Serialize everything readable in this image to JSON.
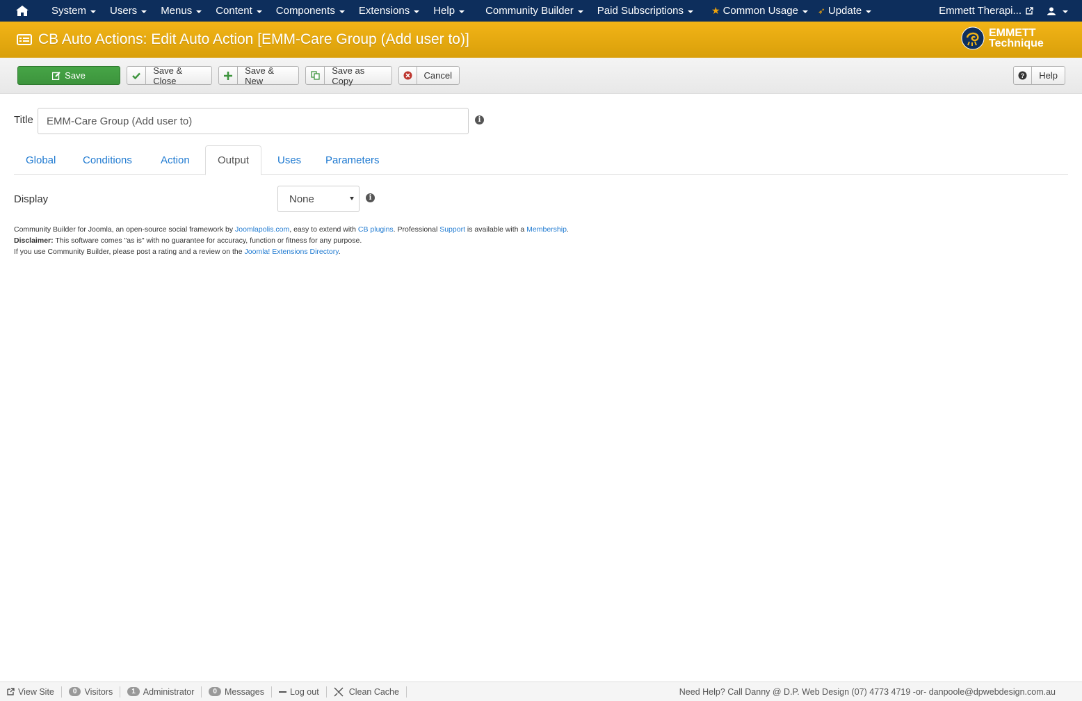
{
  "topnav": {
    "items": [
      "System",
      "Users",
      "Menus",
      "Content",
      "Components",
      "Extensions",
      "Help"
    ],
    "extra": [
      "Community Builder",
      "Paid Subscriptions"
    ],
    "common_usage": "Common Usage",
    "update": "Update",
    "site_name": "Emmett Therapi...",
    "icons": {
      "home": "home-icon",
      "user": "user-icon",
      "external": "external-link-icon"
    }
  },
  "header": {
    "title": "CB Auto Actions: Edit Auto Action [EMM-Care Group (Add user to)]",
    "brand_line1": "EMMETT",
    "brand_line2": "Technique",
    "color": "#e8a811"
  },
  "toolbar": {
    "save": "Save",
    "save_close": "Save & Close",
    "save_new": "Save & New",
    "save_copy": "Save as Copy",
    "cancel": "Cancel",
    "help": "Help"
  },
  "form": {
    "title_label": "Title",
    "title_value": "EMM-Care Group (Add user to)",
    "tabs": [
      "Global",
      "Conditions",
      "Action",
      "Output",
      "Uses",
      "Parameters"
    ],
    "active_tab": "Output",
    "display_label": "Display",
    "display_value": "None"
  },
  "footer": {
    "line1_a": "Community Builder for Joomla, an open-source social framework by ",
    "line1_link1": "Joomlapolis.com",
    "line1_b": ", easy to extend with ",
    "line1_link2": "CB plugins",
    "line1_c": ". Professional ",
    "line1_link3": "Support",
    "line1_d": " is available with a ",
    "line1_link4": "Membership",
    "line1_e": ".",
    "disclaimer_label": "Disclaimer:",
    "disclaimer_text": " This software comes \"as is\" with no guarantee for accuracy, function or fitness for any purpose.",
    "line3_a": "If you use Community Builder, please post a rating and a review on the ",
    "line3_link": "Joomla! Extensions Directory",
    "line3_b": "."
  },
  "statusbar": {
    "view_site": "View Site",
    "visitors_count": "0",
    "visitors": "Visitors",
    "admin_count": "1",
    "admin": "Administrator",
    "messages_count": "0",
    "messages": "Messages",
    "logout": "Log out",
    "clean_cache": "Clean Cache",
    "help_text": "Need Help? Call Danny @ D.P. Web Design (07) 4773 4719 -or- danpoole@dpwebdesign.com.au"
  }
}
